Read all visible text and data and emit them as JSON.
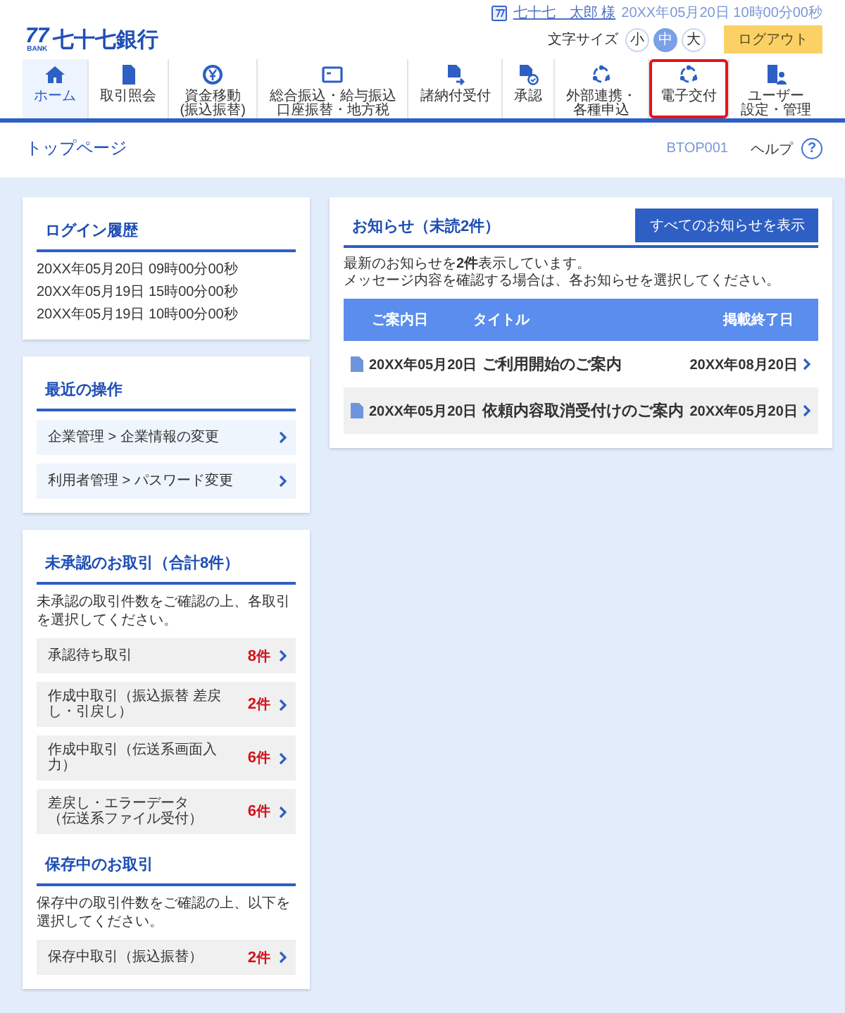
{
  "header": {
    "logo": {
      "mark": "77",
      "sub": "BANK",
      "name": "七十七銀行"
    },
    "user": {
      "name": "七十七　太郎 様",
      "datetime": "20XX年05月20日 10時00分00秒"
    },
    "font_size": {
      "label": "文字サイズ",
      "options": [
        {
          "label": "小",
          "selected": false
        },
        {
          "label": "中",
          "selected": true
        },
        {
          "label": "大",
          "selected": false
        }
      ]
    },
    "logout": "ログアウト"
  },
  "nav": [
    {
      "kind": "home",
      "lines": [
        "ホーム"
      ],
      "selected": true,
      "highlighted": false
    },
    {
      "kind": "document",
      "lines": [
        "取引照会"
      ],
      "selected": false,
      "highlighted": false
    },
    {
      "kind": "yen",
      "lines": [
        "資金移動",
        "(振込振替)"
      ],
      "selected": false,
      "highlighted": false
    },
    {
      "kind": "card",
      "lines": [
        "総合振込・給与振込",
        "口座振替・地方税"
      ],
      "selected": false,
      "highlighted": false
    },
    {
      "kind": "docarrow",
      "lines": [
        "諸納付受付"
      ],
      "selected": false,
      "highlighted": false
    },
    {
      "kind": "doccheck",
      "lines": [
        "承認"
      ],
      "selected": false,
      "highlighted": false
    },
    {
      "kind": "cycle",
      "lines": [
        "外部連携・",
        "各種申込"
      ],
      "selected": false,
      "highlighted": false
    },
    {
      "kind": "cycle",
      "lines": [
        "電子交付"
      ],
      "selected": false,
      "highlighted": true
    },
    {
      "kind": "userbuilding",
      "lines": [
        "ユーザー",
        "設定・管理"
      ],
      "selected": false,
      "highlighted": false
    }
  ],
  "page": {
    "title": "トップページ",
    "code": "BTOP001",
    "help": "ヘルプ",
    "help_icon": "?"
  },
  "login_history": {
    "title": "ログイン履歴",
    "entries": [
      "20XX年05月20日 09時00分00秒",
      "20XX年05月19日 15時00分00秒",
      "20XX年05月19日 10時00分00秒"
    ]
  },
  "recent": {
    "title": "最近の操作",
    "items": [
      "企業管理 > 企業情報の変更",
      "利用者管理 > パスワード変更"
    ]
  },
  "pending": {
    "title": "未承認のお取引（合計8件）",
    "description": "未承認の取引件数をご確認の上、各取引を選択してください。",
    "items": [
      {
        "lines": [
          "承認待ち取引"
        ],
        "count": "8",
        "unit": "件"
      },
      {
        "lines": [
          "作成中取引（振込振替 差戻し・引戻し）"
        ],
        "count": "2",
        "unit": "件"
      },
      {
        "lines": [
          "作成中取引（伝送系画面入力）"
        ],
        "count": "6",
        "unit": "件"
      },
      {
        "lines": [
          "差戻し・エラーデータ",
          "（伝送系ファイル受付）"
        ],
        "count": "6",
        "unit": "件"
      }
    ]
  },
  "saved": {
    "title": "保存中のお取引",
    "description": "保存中の取引件数をご確認の上、以下を選択してください。",
    "items": [
      {
        "lines": [
          "保存中取引（振込振替）"
        ],
        "count": "2",
        "unit": "件"
      }
    ]
  },
  "notices": {
    "title": "お知らせ（未読2件）",
    "button": "すべてのお知らせを表示",
    "messages": [
      "最新のお知らせを**2件**表示しています。",
      "メッセージ内容を確認する場合は、各お知らせを選択してください。"
    ],
    "columns": [
      "ご案内日",
      "タイトル",
      "掲載終了日"
    ],
    "rows": [
      {
        "date": "20XX年05月20日",
        "title": "ご利用開始のご案内",
        "end_date": "20XX年08月20日"
      },
      {
        "date": "20XX年05月20日",
        "title": "依頼内容取消受付けのご案内",
        "end_date": "20XX年05月20日"
      }
    ]
  }
}
